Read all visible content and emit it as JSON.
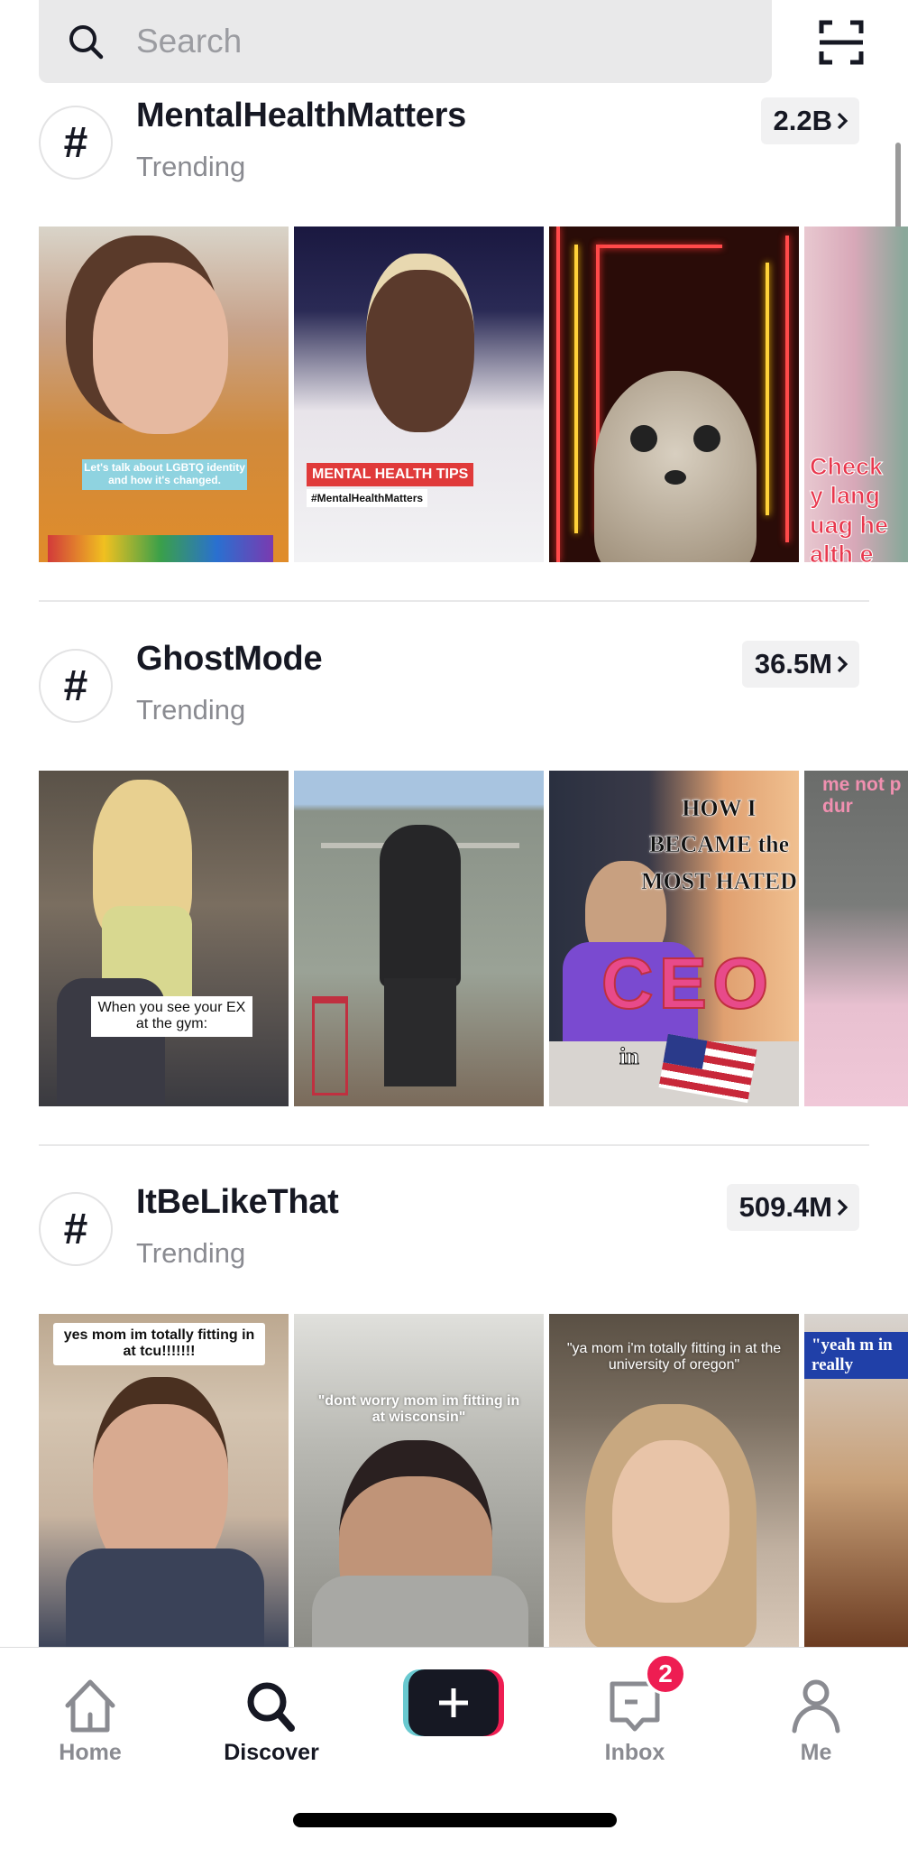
{
  "search": {
    "placeholder": "Search",
    "value": ""
  },
  "icons": {
    "search": "search-icon",
    "scan": "scan-qr-icon",
    "hashtag": "hashtag-icon",
    "chevron": "chevron-right-icon"
  },
  "sections": [
    {
      "hashtag_symbol": "#",
      "title": "MentalHealthMatters",
      "subtitle": "Trending",
      "count": "2.2B",
      "thumbnails": [
        {
          "caption": "Let's talk about LGBTQ identity and how it's changed."
        },
        {
          "caption": "MENTAL HEALTH TIPS",
          "caption2": "#MentalHealthMatters"
        },
        {
          "caption": ""
        },
        {
          "caption": "Check y languag health e"
        }
      ]
    },
    {
      "hashtag_symbol": "#",
      "title": "GhostMode",
      "subtitle": "Trending",
      "count": "36.5M",
      "thumbnails": [
        {
          "caption": "When you see your EX at the gym:"
        },
        {
          "caption": ""
        },
        {
          "caption": "HOW I BECAME the MOST HATED",
          "caption2": "CEO",
          "caption3": "in"
        },
        {
          "caption": "me not p dur"
        }
      ]
    },
    {
      "hashtag_symbol": "#",
      "title": "ItBeLikeThat",
      "subtitle": "Trending",
      "count": "509.4M",
      "thumbnails": [
        {
          "caption": "yes mom im totally fitting in at tcu!!!!!!!"
        },
        {
          "caption": "\"dont worry mom im fitting in at wisconsin\""
        },
        {
          "caption": "\"ya mom i'm totally fitting in at the university of oregon\""
        },
        {
          "caption": "\"yeah m in really"
        }
      ]
    }
  ],
  "tabbar": {
    "items": [
      {
        "label": "Home",
        "icon": "home-icon",
        "active": false
      },
      {
        "label": "Discover",
        "icon": "search-icon",
        "active": true
      },
      {
        "label": "",
        "icon": "plus-icon",
        "active": false
      },
      {
        "label": "Inbox",
        "icon": "inbox-icon",
        "active": false,
        "badge": "2"
      },
      {
        "label": "Me",
        "icon": "profile-icon",
        "active": false
      }
    ]
  },
  "colors": {
    "text_primary": "#161823",
    "text_secondary": "#8a8b91",
    "search_bg": "#e9e9ea",
    "badge_red": "#ee1d52",
    "create_cyan": "#69c9d0",
    "create_pink": "#ee1d52"
  }
}
